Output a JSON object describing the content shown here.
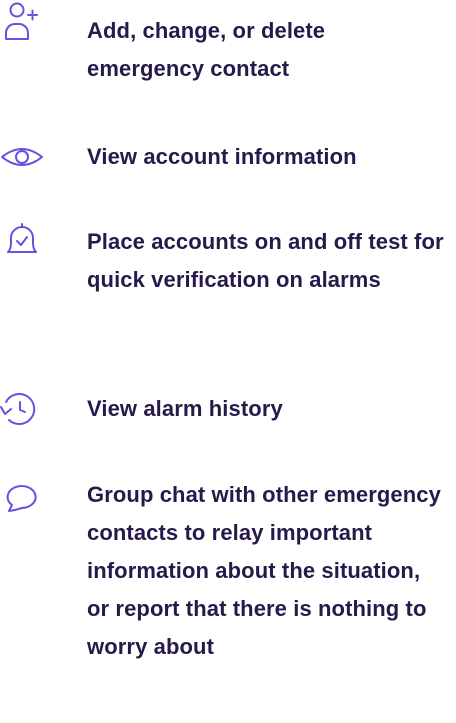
{
  "colors": {
    "text": "#271a4a",
    "icon": "#6c4fe0",
    "background": "#ffffff"
  },
  "features": [
    {
      "icon": "add-user-icon",
      "text": "Add, change, or delete emergency contact"
    },
    {
      "icon": "eye-icon",
      "text": "View account information"
    },
    {
      "icon": "bell-check-icon",
      "text": "Place accounts on and off test for quick verification on alarms"
    },
    {
      "icon": "history-icon",
      "text": "View alarm history"
    },
    {
      "icon": "chat-bubble-icon",
      "text": "Group chat with other emergency contacts to relay important information about the situation, or report that there is nothing to worry about"
    }
  ]
}
